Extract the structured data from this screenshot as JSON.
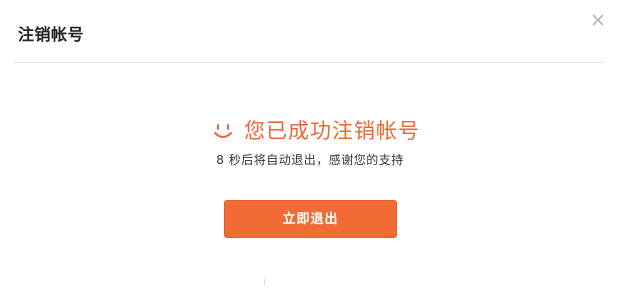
{
  "dialog": {
    "title": "注销帐号",
    "close_icon": "close-icon"
  },
  "message": {
    "icon": "smile-icon",
    "text": "您已成功注销帐号",
    "countdown": "8 秒后将自动退出，感谢您的支持"
  },
  "actions": {
    "logout_label": "立即退出"
  },
  "colors": {
    "accent": "#ee6633",
    "button": "#f16b36",
    "title": "#222222",
    "text": "#333333",
    "divider": "#e3e3e3"
  }
}
